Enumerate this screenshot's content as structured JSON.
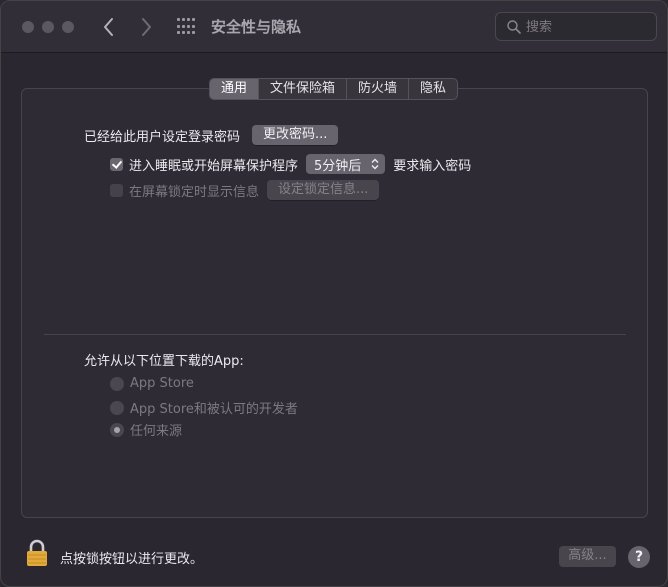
{
  "window": {
    "title": "安全性与隐私",
    "nav": {
      "back_glyph": "‹",
      "forward_glyph": "›"
    }
  },
  "search": {
    "placeholder": "搜索",
    "value": ""
  },
  "tabs": [
    {
      "label": "通用",
      "active": true
    },
    {
      "label": "文件保险箱",
      "active": false
    },
    {
      "label": "防火墙",
      "active": false
    },
    {
      "label": "隐私",
      "active": false
    }
  ],
  "general": {
    "password_set_label": "已经给此用户设定登录密码",
    "change_password_button": "更改密码...",
    "require_password": {
      "checked": true,
      "label_before": "进入睡眠或开始屏幕保护程序",
      "popup_value": "5分钟后",
      "label_after": "要求输入密码"
    },
    "show_message": {
      "checked": false,
      "disabled": true,
      "label": "在屏幕锁定时显示信息",
      "button": "设定锁定信息..."
    },
    "download": {
      "heading": "允许从以下位置下载的App:",
      "options": [
        {
          "label": "App Store",
          "selected": false
        },
        {
          "label": "App Store和被认可的开发者",
          "selected": false
        },
        {
          "label": "任何来源",
          "selected": true
        }
      ]
    }
  },
  "footer": {
    "lock_text": "点按锁按钮以进行更改。",
    "advanced_button": "高级...",
    "help_glyph": "?"
  },
  "colors": {
    "window_bg": "#2a2731",
    "panel_bg": "#2e2b34",
    "button_bg": "#67646d",
    "lock_gold": "#e2a93b"
  }
}
